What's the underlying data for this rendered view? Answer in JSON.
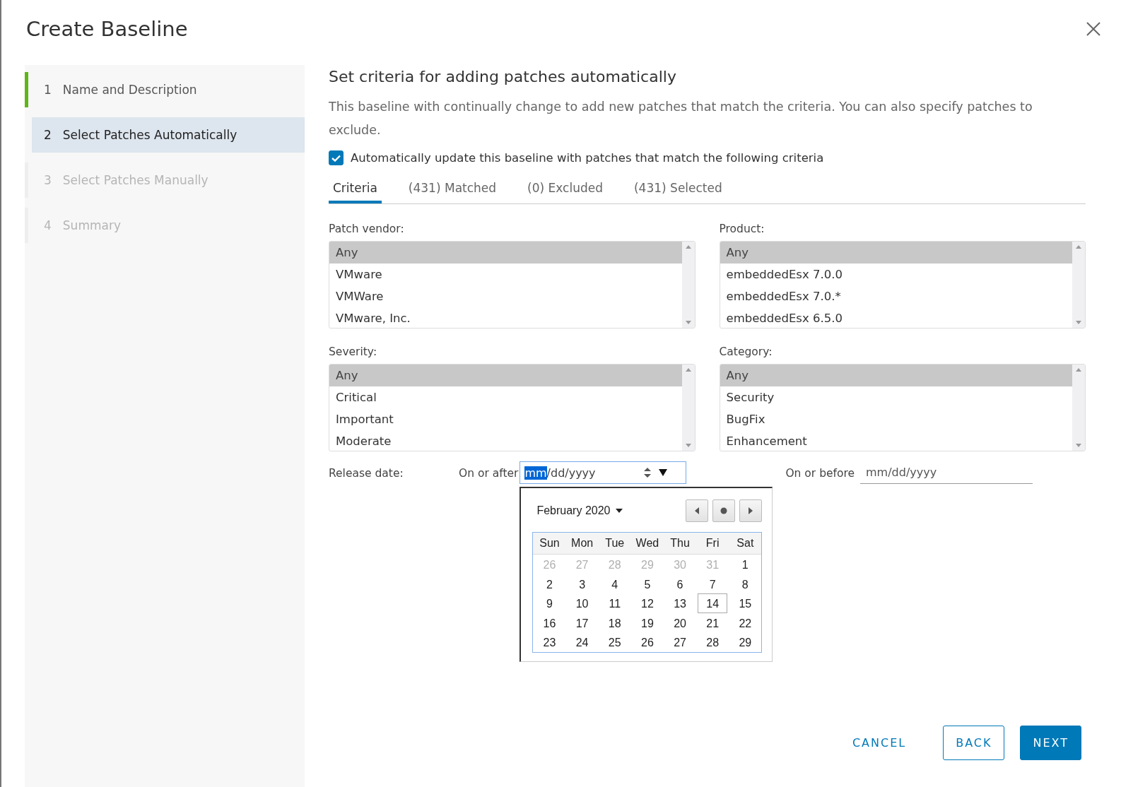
{
  "dialog": {
    "title": "Create Baseline"
  },
  "steps": [
    {
      "number": "1",
      "label": "Name and Description",
      "selected": false,
      "disabled": false,
      "completed": true
    },
    {
      "number": "2",
      "label": "Select Patches Automatically",
      "selected": true,
      "disabled": false,
      "completed": false
    },
    {
      "number": "3",
      "label": "Select Patches Manually",
      "selected": false,
      "disabled": true,
      "completed": false
    },
    {
      "number": "4",
      "label": "Summary",
      "selected": false,
      "disabled": true,
      "completed": false
    }
  ],
  "heading": "Set criteria for adding patches automatically",
  "description": "This baseline with continually change to add new patches that match the criteria. You can also specify patches to exclude.",
  "auto_update": {
    "label": "Automatically update this baseline with patches that match the following criteria",
    "checked": true
  },
  "tabs": [
    {
      "label": "Criteria",
      "selected": true
    },
    {
      "label": "(431) Matched",
      "selected": false
    },
    {
      "label": "(0) Excluded",
      "selected": false
    },
    {
      "label": "(431) Selected",
      "selected": false
    }
  ],
  "filters": [
    {
      "label": "Patch vendor:",
      "items": [
        {
          "text": "Any",
          "selected": true
        },
        {
          "text": "VMware",
          "selected": false
        },
        {
          "text": "VMWare",
          "selected": false
        },
        {
          "text": "VMware, Inc.",
          "selected": false
        }
      ]
    },
    {
      "label": "Product:",
      "items": [
        {
          "text": "Any",
          "selected": true
        },
        {
          "text": "embeddedEsx 7.0.0",
          "selected": false
        },
        {
          "text": "embeddedEsx 7.0.*",
          "selected": false
        },
        {
          "text": "embeddedEsx 6.5.0",
          "selected": false
        }
      ]
    },
    {
      "label": "Severity:",
      "items": [
        {
          "text": "Any",
          "selected": true
        },
        {
          "text": "Critical",
          "selected": false
        },
        {
          "text": "Important",
          "selected": false
        },
        {
          "text": "Moderate",
          "selected": false
        }
      ]
    },
    {
      "label": "Category:",
      "items": [
        {
          "text": "Any",
          "selected": true
        },
        {
          "text": "Security",
          "selected": false
        },
        {
          "text": "BugFix",
          "selected": false
        },
        {
          "text": "Enhancement",
          "selected": false
        }
      ]
    }
  ],
  "release_date": {
    "label": "Release date:",
    "after": {
      "label": "On or after",
      "segments": [
        {
          "text": "mm",
          "selected": true
        },
        {
          "text": "/dd/yyyy",
          "selected": false
        }
      ]
    },
    "before": {
      "label": "On or before",
      "placeholder": "mm/dd/yyyy"
    }
  },
  "calendar": {
    "month": "February 2020",
    "weekdays": [
      "Sun",
      "Mon",
      "Tue",
      "Wed",
      "Thu",
      "Fri",
      "Sat"
    ],
    "weeks": [
      [
        {
          "day": "26",
          "other_month": true,
          "today": false
        },
        {
          "day": "27",
          "other_month": true,
          "today": false
        },
        {
          "day": "28",
          "other_month": true,
          "today": false
        },
        {
          "day": "29",
          "other_month": true,
          "today": false
        },
        {
          "day": "30",
          "other_month": true,
          "today": false
        },
        {
          "day": "31",
          "other_month": true,
          "today": false
        },
        {
          "day": "1",
          "other_month": false,
          "today": false
        }
      ],
      [
        {
          "day": "2",
          "other_month": false,
          "today": false
        },
        {
          "day": "3",
          "other_month": false,
          "today": false
        },
        {
          "day": "4",
          "other_month": false,
          "today": false
        },
        {
          "day": "5",
          "other_month": false,
          "today": false
        },
        {
          "day": "6",
          "other_month": false,
          "today": false
        },
        {
          "day": "7",
          "other_month": false,
          "today": false
        },
        {
          "day": "8",
          "other_month": false,
          "today": false
        }
      ],
      [
        {
          "day": "9",
          "other_month": false,
          "today": false
        },
        {
          "day": "10",
          "other_month": false,
          "today": false
        },
        {
          "day": "11",
          "other_month": false,
          "today": false
        },
        {
          "day": "12",
          "other_month": false,
          "today": false
        },
        {
          "day": "13",
          "other_month": false,
          "today": false
        },
        {
          "day": "14",
          "other_month": false,
          "today": true
        },
        {
          "day": "15",
          "other_month": false,
          "today": false
        }
      ],
      [
        {
          "day": "16",
          "other_month": false,
          "today": false
        },
        {
          "day": "17",
          "other_month": false,
          "today": false
        },
        {
          "day": "18",
          "other_month": false,
          "today": false
        },
        {
          "day": "19",
          "other_month": false,
          "today": false
        },
        {
          "day": "20",
          "other_month": false,
          "today": false
        },
        {
          "day": "21",
          "other_month": false,
          "today": false
        },
        {
          "day": "22",
          "other_month": false,
          "today": false
        }
      ],
      [
        {
          "day": "23",
          "other_month": false,
          "today": false
        },
        {
          "day": "24",
          "other_month": false,
          "today": false
        },
        {
          "day": "25",
          "other_month": false,
          "today": false
        },
        {
          "day": "26",
          "other_month": false,
          "today": false
        },
        {
          "day": "27",
          "other_month": false,
          "today": false
        },
        {
          "day": "28",
          "other_month": false,
          "today": false
        },
        {
          "day": "29",
          "other_month": false,
          "today": false
        }
      ]
    ]
  },
  "buttons": [
    {
      "label": "CANCEL",
      "kind": "flat"
    },
    {
      "label": "BACK",
      "kind": "outline"
    },
    {
      "label": "NEXT",
      "kind": "primary"
    }
  ]
}
